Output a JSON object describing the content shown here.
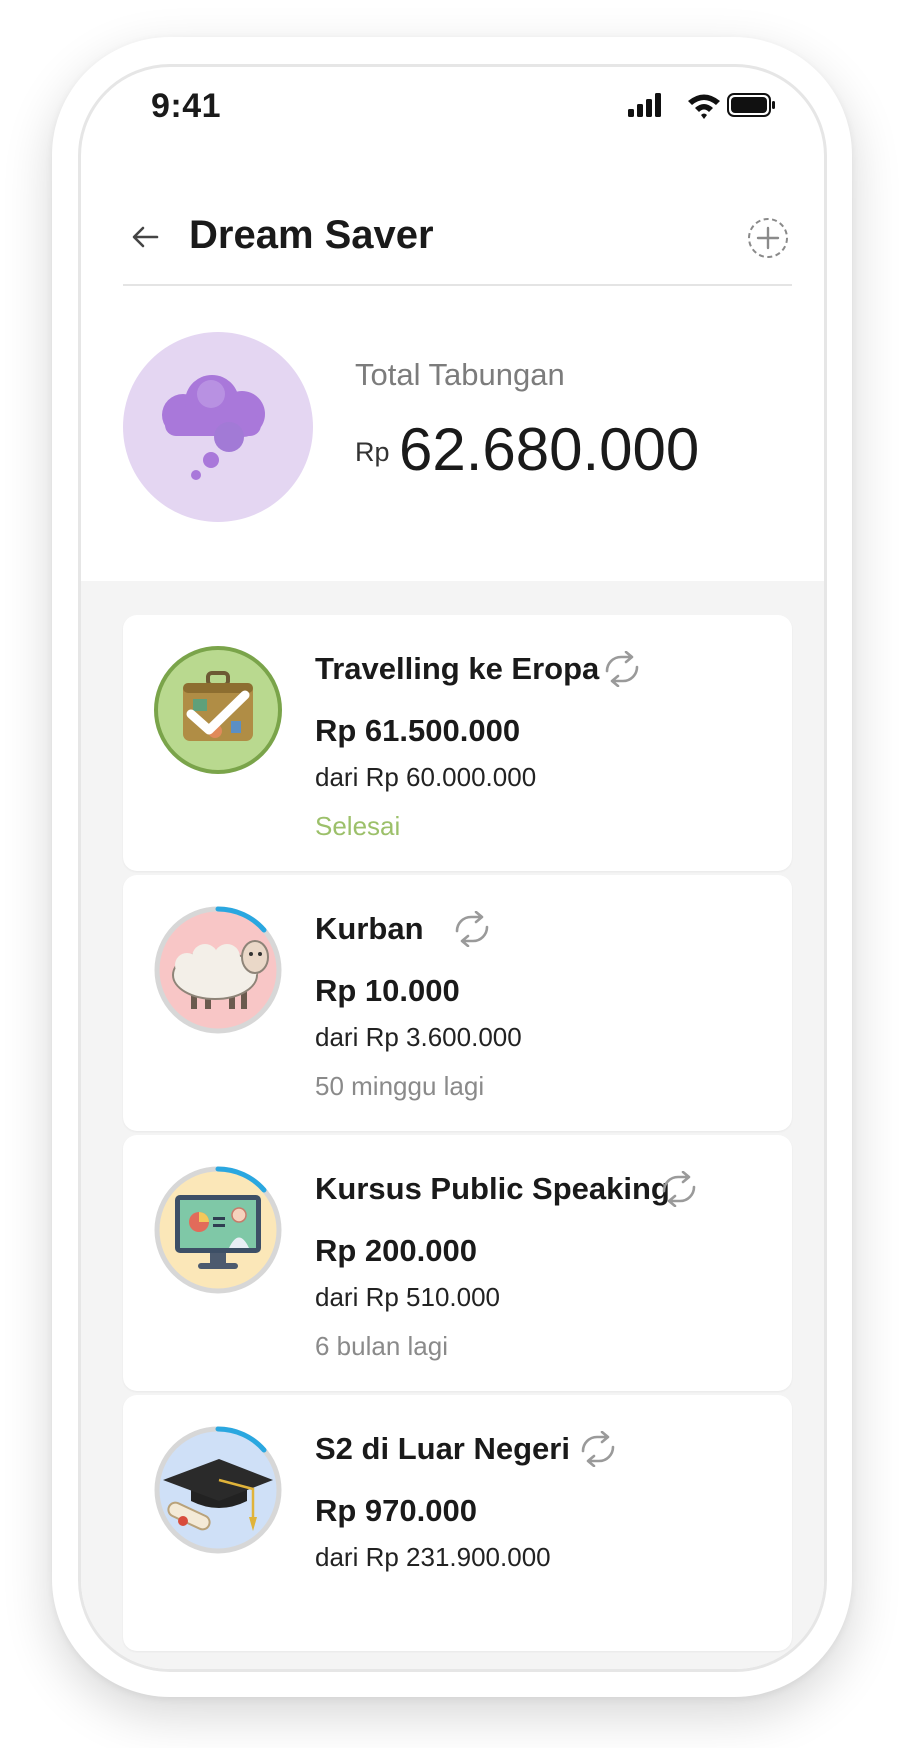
{
  "status_bar": {
    "time": "9:41"
  },
  "header": {
    "title": "Dream Saver"
  },
  "summary": {
    "label": "Total Tabungan",
    "currency": "Rp",
    "amount": "62.680.000"
  },
  "colors": {
    "accent_done": "#9cc06a",
    "progress": "#2aa7e0",
    "summary_circle": "#e4d6f2"
  },
  "goals": [
    {
      "name": "Travelling ke Eropa",
      "amount": "Rp 61.500.000",
      "target": "dari Rp 60.000.000",
      "status": "Selesai",
      "icon": "suitcase-icon",
      "completed": true,
      "progress": 1.0
    },
    {
      "name": "Kurban",
      "amount": "Rp 10.000",
      "target": "dari Rp 3.600.000",
      "status": "50 minggu lagi",
      "icon": "sheep-icon",
      "completed": false,
      "progress": 0.1
    },
    {
      "name": "Kursus Public Speaking",
      "amount": "Rp 200.000",
      "target": "dari Rp 510.000",
      "status": "6 bulan lagi",
      "icon": "presentation-icon",
      "completed": false,
      "progress": 0.1
    },
    {
      "name": "S2 di Luar Negeri",
      "amount": "Rp 970.000",
      "target": "dari Rp 231.900.000",
      "status": "",
      "icon": "graduation-cap-icon",
      "completed": false,
      "progress": 0.1
    }
  ]
}
